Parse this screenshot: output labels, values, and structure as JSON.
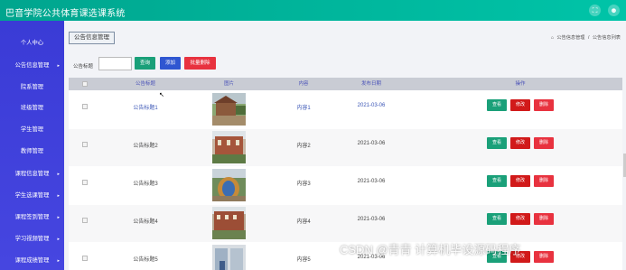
{
  "app": {
    "title": "巴音学院公共体育课选课系统"
  },
  "topbar": {
    "icons": [
      "expand-icon",
      "user-icon"
    ],
    "expand_glyph": "⛶",
    "user_glyph": "☻"
  },
  "sidebar": {
    "items": [
      {
        "label": "个人中心",
        "has_arrow": false
      },
      {
        "label": "公告信息管理",
        "has_arrow": true
      },
      {
        "label": "院系管理",
        "has_arrow": false
      },
      {
        "label": "班级管理",
        "has_arrow": false
      },
      {
        "label": "学生管理",
        "has_arrow": false
      },
      {
        "label": "教师管理",
        "has_arrow": false
      },
      {
        "label": "课程信息管理",
        "has_arrow": true
      },
      {
        "label": "学生选课管理",
        "has_arrow": true
      },
      {
        "label": "课程签到管理",
        "has_arrow": true
      },
      {
        "label": "学习视频管理",
        "has_arrow": true
      },
      {
        "label": "课程成绩管理",
        "has_arrow": true
      }
    ],
    "arrow_glyph": "▸"
  },
  "tab": {
    "label": "公告信息管理"
  },
  "breadcrumb": {
    "home_glyph": "⌂",
    "items": [
      "公告信息管理",
      "公告信息列表"
    ],
    "separator": "/"
  },
  "search": {
    "label": "公告标题",
    "value": "",
    "placeholder": ""
  },
  "buttons": {
    "query": "查询",
    "add": "添加",
    "batch_delete": "批量删除"
  },
  "colors": {
    "green": "#1aa079",
    "blue": "#2f56d1",
    "red": "#e8323f",
    "dark_red": "#d12a2a",
    "sidebar": "#3d3ed9",
    "topbar": "#00b59b"
  },
  "table": {
    "headers": [
      "公告标题",
      "图片",
      "内容",
      "发布日期",
      "操作"
    ],
    "rows": [
      {
        "title": "公告标题1",
        "content": "内容1",
        "date": "2021-03-06",
        "highlight": true
      },
      {
        "title": "公告标题2",
        "content": "内容2",
        "date": "2021-03-06",
        "highlight": false
      },
      {
        "title": "公告标题3",
        "content": "内容3",
        "date": "2021-03-06",
        "highlight": false
      },
      {
        "title": "公告标题4",
        "content": "内容4",
        "date": "2021-03-06",
        "highlight": false
      },
      {
        "title": "公告标题5",
        "content": "内容5",
        "date": "2021-03-06",
        "highlight": false
      }
    ],
    "actions": {
      "view": "查看",
      "edit": "修改",
      "delete": "删除"
    }
  },
  "watermark": {
    "text": "CSDN @青青  计算机毕设源码程序"
  }
}
